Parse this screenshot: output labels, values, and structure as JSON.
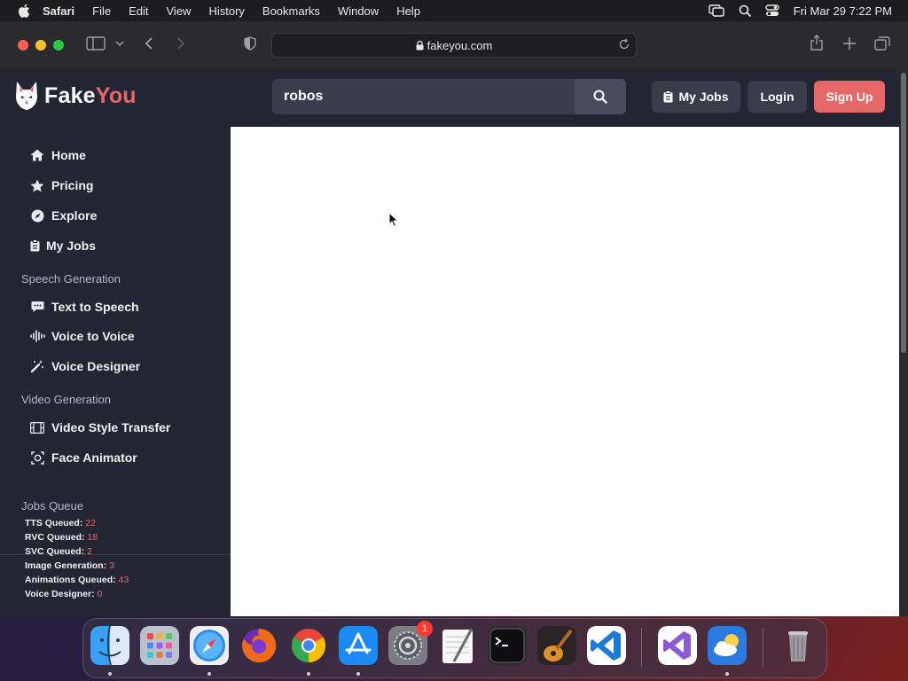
{
  "menubar": {
    "app": "Safari",
    "items": [
      "File",
      "Edit",
      "View",
      "History",
      "Bookmarks",
      "Window",
      "Help"
    ],
    "clock": "Fri Mar 29  7:22 PM"
  },
  "browser": {
    "url": "fakeyou.com"
  },
  "site": {
    "brand_a": "Fake",
    "brand_b": "You",
    "search_value": "robos",
    "buttons": {
      "my_jobs": "My Jobs",
      "login": "Login",
      "signup": "Sign Up"
    },
    "nav": {
      "home": "Home",
      "pricing": "Pricing",
      "explore": "Explore",
      "my_jobs": "My Jobs"
    },
    "speech_section": "Speech Generation",
    "speech": {
      "tts": "Text to Speech",
      "v2v": "Voice to Voice",
      "designer": "Voice Designer"
    },
    "video_section": "Video Generation",
    "video": {
      "style": "Video Style Transfer",
      "face": "Face Animator"
    },
    "queue": {
      "title": "Jobs Queue",
      "rows": [
        {
          "label": "TTS Queued:",
          "value": "22"
        },
        {
          "label": "RVC Queued:",
          "value": "18"
        },
        {
          "label": "SVC Queued:",
          "value": "2"
        },
        {
          "label": "Image Generation:",
          "value": "3"
        },
        {
          "label": "Animations Queued:",
          "value": "43"
        },
        {
          "label": "Voice Designer:",
          "value": "0"
        }
      ]
    }
  },
  "dock": {
    "settings_badge": "1"
  },
  "colors": {
    "accent": "#e66767",
    "page_bg": "#242533",
    "panel": "#3a3b4b"
  }
}
